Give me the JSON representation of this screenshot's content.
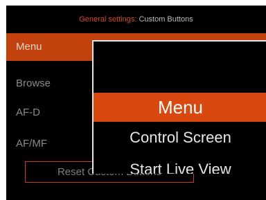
{
  "header": {
    "prefix": "General settings:",
    "title": "Custom Buttons"
  },
  "menu_rows": [
    {
      "label": "Menu"
    },
    {
      "label": "Browse"
    },
    {
      "label": "AF-D"
    },
    {
      "label": "AF/MF"
    }
  ],
  "reset_button": {
    "label": "Reset Custom Buttons"
  },
  "popup": {
    "options": [
      {
        "label": "Menu"
      },
      {
        "label": "Control Screen"
      },
      {
        "label": "Start Live View"
      }
    ]
  },
  "colors": {
    "accent": "#c2410c",
    "popup_selected": "#d9480f",
    "background": "#000000"
  }
}
